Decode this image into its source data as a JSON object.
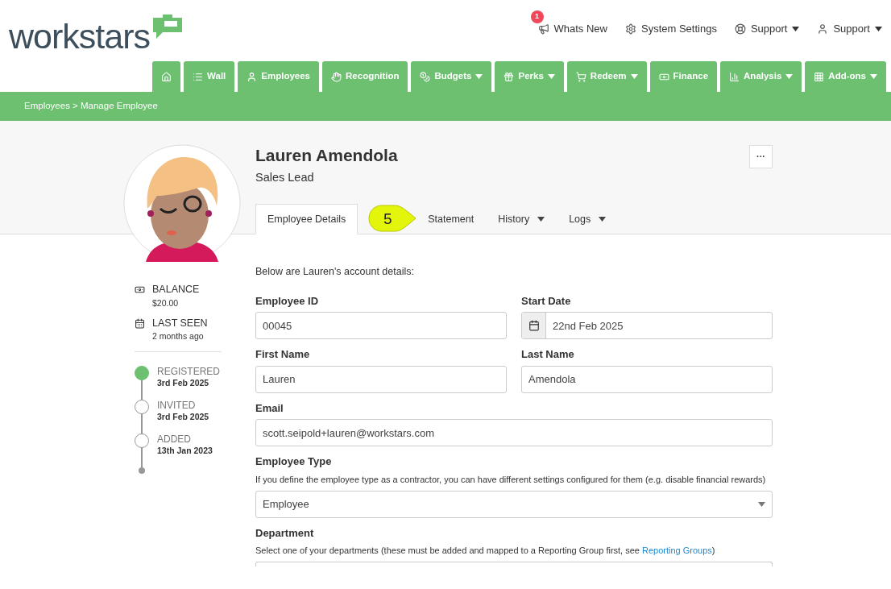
{
  "logo": {
    "text": "workstars"
  },
  "top_links": [
    {
      "label": "Whats New",
      "badge": "1",
      "has_menu": false
    },
    {
      "label": "System Settings",
      "has_menu": false
    },
    {
      "label": "Support",
      "has_menu": true
    },
    {
      "label": "Support",
      "has_menu": true
    }
  ],
  "nav": [
    {
      "has_menu": false
    },
    {
      "label": "Wall",
      "has_menu": false
    },
    {
      "label": "Employees",
      "has_menu": false
    },
    {
      "label": "Recognition",
      "has_menu": false
    },
    {
      "label": "Budgets",
      "has_menu": true
    },
    {
      "label": "Perks",
      "has_menu": true
    },
    {
      "label": "Redeem",
      "has_menu": true
    },
    {
      "label": "Finance",
      "has_menu": false
    },
    {
      "label": "Analysis",
      "has_menu": true
    },
    {
      "label": "Add-ons",
      "has_menu": true
    }
  ],
  "breadcrumb": "Employees > Manage Employee",
  "profile": {
    "name": "Lauren Amendola",
    "role": "Sales Lead",
    "more": "···"
  },
  "tabs": [
    {
      "label": "Employee Details",
      "selected": true,
      "has_menu": false
    },
    {
      "label": "Statement",
      "selected": false,
      "has_menu": false
    },
    {
      "label": "History",
      "selected": false,
      "has_menu": true
    },
    {
      "label": "Logs",
      "selected": false,
      "has_menu": true
    }
  ],
  "callout": {
    "label": "5"
  },
  "stats": [
    {
      "label": "BALANCE",
      "value": "$20.00"
    },
    {
      "label": "LAST SEEN",
      "value": "2 months ago"
    }
  ],
  "timeline": [
    {
      "label": "REGISTERED",
      "date": "3rd Feb 2025",
      "done": true
    },
    {
      "label": "INVITED",
      "date": "3rd Feb 2025",
      "done": false
    },
    {
      "label": "ADDED",
      "date": "13th Jan 2023",
      "done": false
    }
  ],
  "intro": "Below are Lauren's account details:",
  "field_rows": [
    [
      {
        "kind": "text",
        "label": "Employee ID",
        "value": "00045"
      },
      {
        "kind": "date",
        "label": "Start Date",
        "value": "22nd Feb 2025"
      }
    ],
    [
      {
        "kind": "text",
        "label": "First Name",
        "value": "Lauren"
      },
      {
        "kind": "text",
        "label": "Last Name",
        "value": "Amendola"
      }
    ],
    [
      {
        "kind": "text",
        "label": "Email",
        "value": "scott.seipold+lauren@workstars.com"
      }
    ],
    [
      {
        "kind": "select",
        "label": "Employee Type",
        "help": "If you define the employee type as a contractor, you can have different settings configured for them (e.g. disable financial rewards)",
        "value": "Employee"
      }
    ],
    [
      {
        "kind": "select_cut",
        "label": "Department",
        "help": "Select one of your departments (these must be added and mapped to a Reporting Group first, see ",
        "link": "Reporting Groups",
        "help_end": ")"
      }
    ]
  ]
}
